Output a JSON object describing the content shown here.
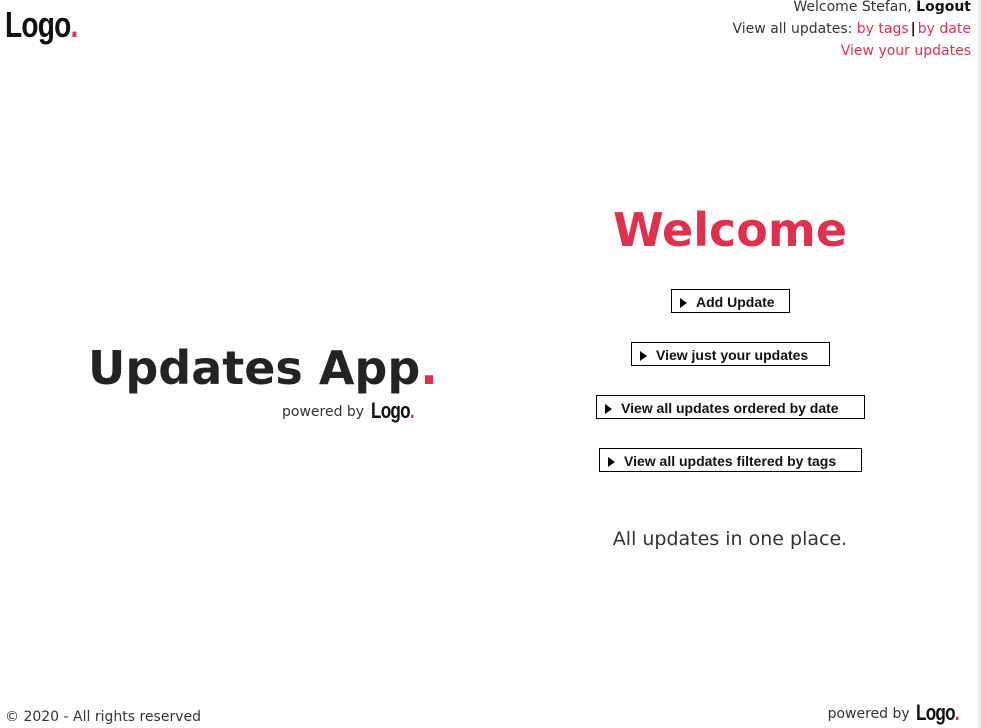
{
  "header": {
    "logo_text": "Logo",
    "logo_dot": ".",
    "welcome_prefix": "Welcome Stefan,",
    "logout_label": "Logout",
    "view_all_prefix": "View all updates:",
    "by_tags_label": "by tags",
    "separator": "|",
    "by_date_label": "by date",
    "view_yours_label": "View your updates"
  },
  "hero": {
    "app_title": "Updates App",
    "app_title_dot": ".",
    "powered_by": "powered by",
    "powered_logo": "Logo",
    "powered_logo_dot": "."
  },
  "main": {
    "welcome_heading": "Welcome",
    "actions": [
      {
        "label": "Add Update"
      },
      {
        "label": "View just your updates"
      },
      {
        "label": "View all updates ordered by date"
      },
      {
        "label": "View all updates filtered by tags"
      }
    ],
    "tagline": "All updates in one place."
  },
  "footer": {
    "copyright": "© 2020 - All rights reserved",
    "powered_by": "powered by",
    "logo_text": "Logo",
    "logo_dot": "."
  },
  "colors": {
    "accent": "#e0304e",
    "text": "#222222",
    "background": "#ffffff"
  },
  "icons": {
    "action_marker": "play-triangle-icon"
  }
}
